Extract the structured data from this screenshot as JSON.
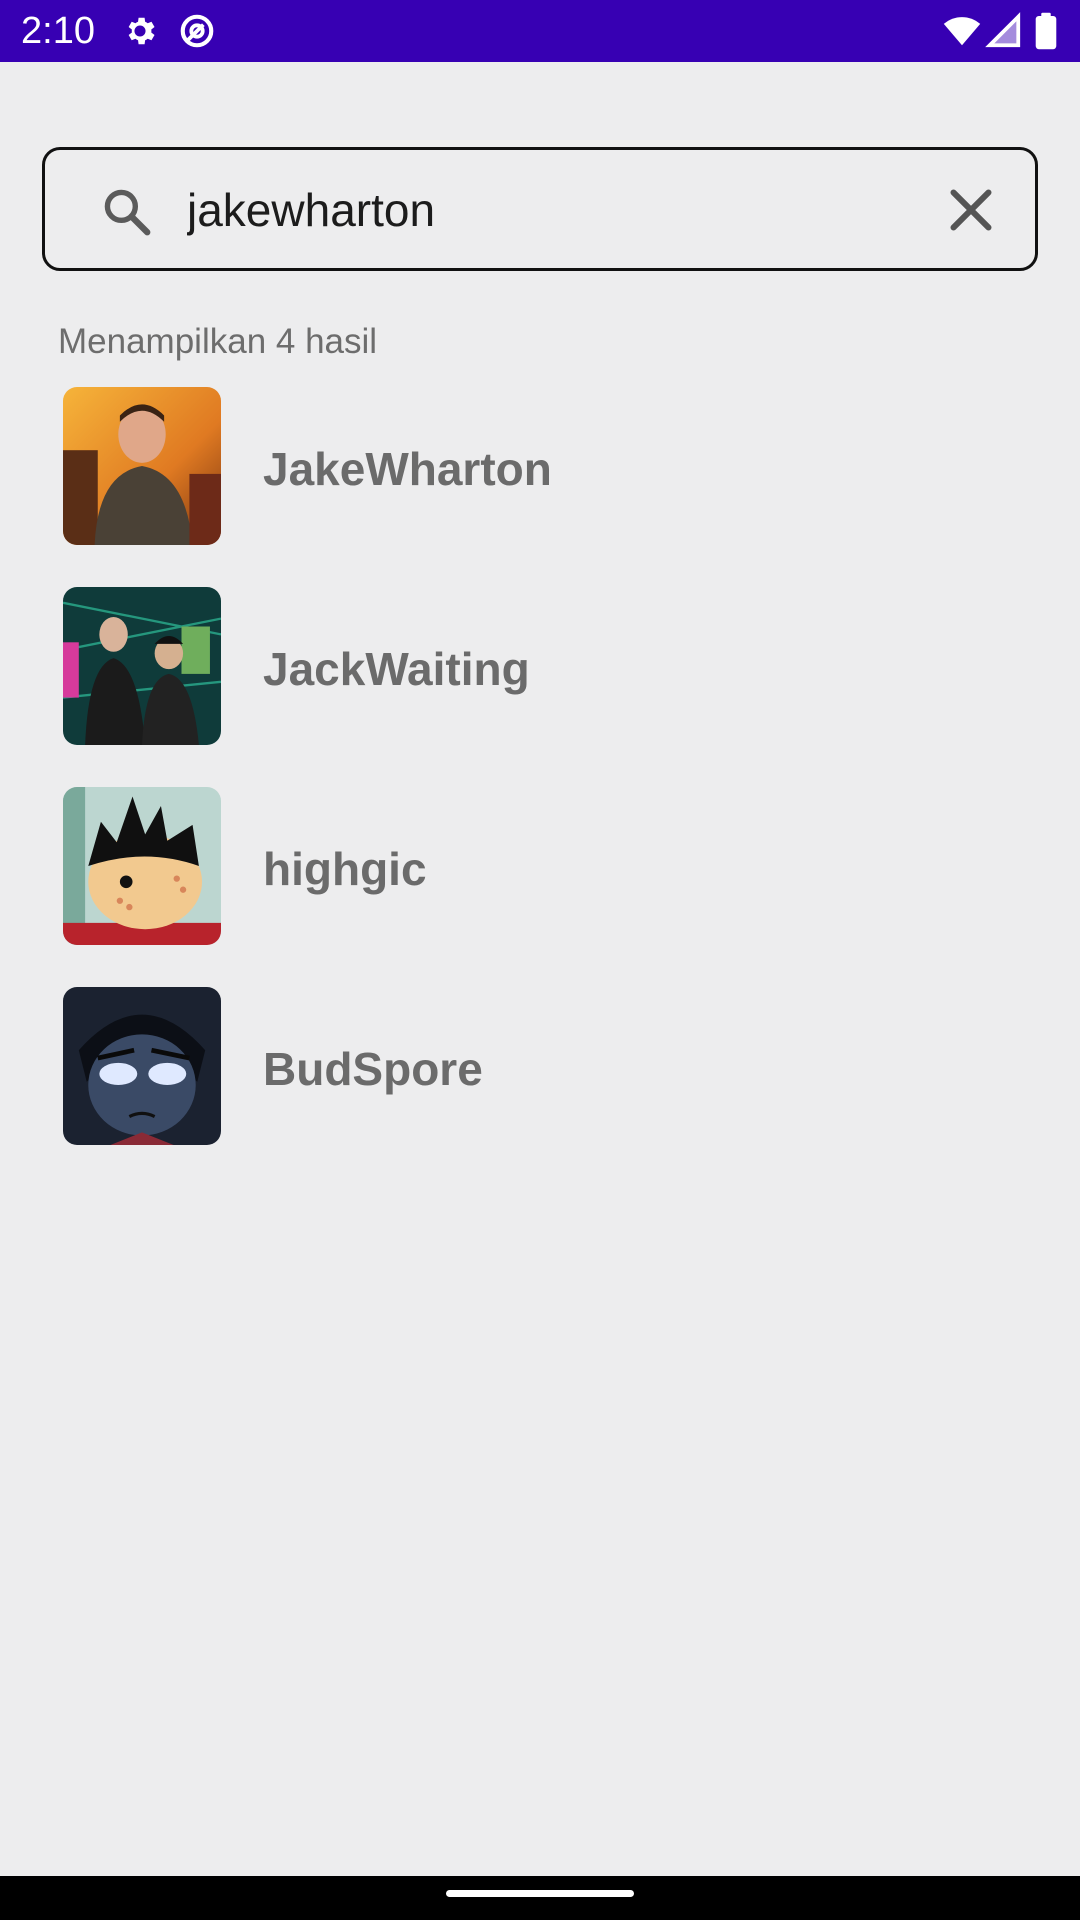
{
  "status_bar": {
    "time": "2:10",
    "icons": [
      "gear-icon",
      "sync-icon",
      "wifi-icon",
      "signal-icon",
      "battery-icon"
    ],
    "background": "#3700B3"
  },
  "search": {
    "value": "jakewharton",
    "icon": "search-icon",
    "clear_icon": "close-icon"
  },
  "results": {
    "count_text": "Menampilkan 4 hasil",
    "items": [
      {
        "username": "JakeWharton",
        "avatar": "avatar-photo"
      },
      {
        "username": "JackWaiting",
        "avatar": "avatar-photo"
      },
      {
        "username": "highgic",
        "avatar": "avatar-cartoon"
      },
      {
        "username": "BudSpore",
        "avatar": "avatar-anime"
      }
    ]
  },
  "colors": {
    "background": "#EDEDEE",
    "username_text": "#6B6B6B",
    "secondary_text": "#6D6D6D"
  }
}
